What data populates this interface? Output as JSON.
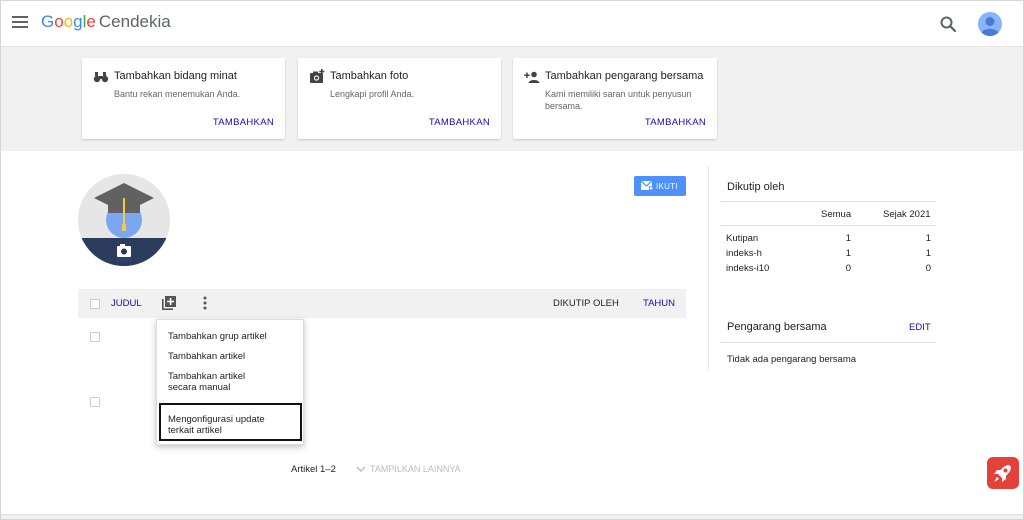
{
  "header": {
    "logo_text": "Google",
    "logo_product": "Cendekia",
    "menu_icon": "hamburger-menu-icon",
    "search_icon": "search-icon",
    "account_icon": "account-avatar-icon"
  },
  "suggestions": [
    {
      "title": "Tambahkan bidang minat",
      "description": "Bantu rekan menemukan Anda.",
      "action": "TAMBAHKAN",
      "icon": "binoculars-icon"
    },
    {
      "title": "Tambahkan foto",
      "description": "Lengkapi profil Anda.",
      "action": "TAMBAHKAN",
      "icon": "add-photo-icon"
    },
    {
      "title": "Tambahkan pengarang bersama",
      "description": "Kami memiliki saran untuk penyusun bersama.",
      "action": "TAMBAHKAN",
      "icon": "add-person-icon"
    }
  ],
  "profile": {
    "follow_label": "IKUTI"
  },
  "articles_toolbar": {
    "title_label": "JUDUL",
    "cited_by_label": "DIKUTIP OLEH",
    "year_label": "TAHUN"
  },
  "add_menu": {
    "items": [
      "Tambahkan grup artikel",
      "Tambahkan artikel",
      "Tambahkan artikel secara manual",
      "Mengonfigurasi update terkait artikel"
    ]
  },
  "articles_footer": {
    "range_label": "Artikel 1–2",
    "show_more_label": "TAMPILKAN LAINNYA"
  },
  "cited_by": {
    "title": "Dikutip oleh",
    "col_all": "Semua",
    "col_since": "Sejak 2021",
    "rows": [
      {
        "label": "Kutipan",
        "all": "1",
        "since": "1"
      },
      {
        "label": "indeks-h",
        "all": "1",
        "since": "1"
      },
      {
        "label": "indeks-i10",
        "all": "0",
        "since": "0"
      }
    ]
  },
  "coauthors": {
    "title": "Pengarang bersama",
    "edit_label": "EDIT",
    "empty_text": "Tidak ada pengarang bersama"
  },
  "colors": {
    "link": "#1a0dab",
    "follow_button": "#4d90fe",
    "rocket": "#e5413b"
  }
}
